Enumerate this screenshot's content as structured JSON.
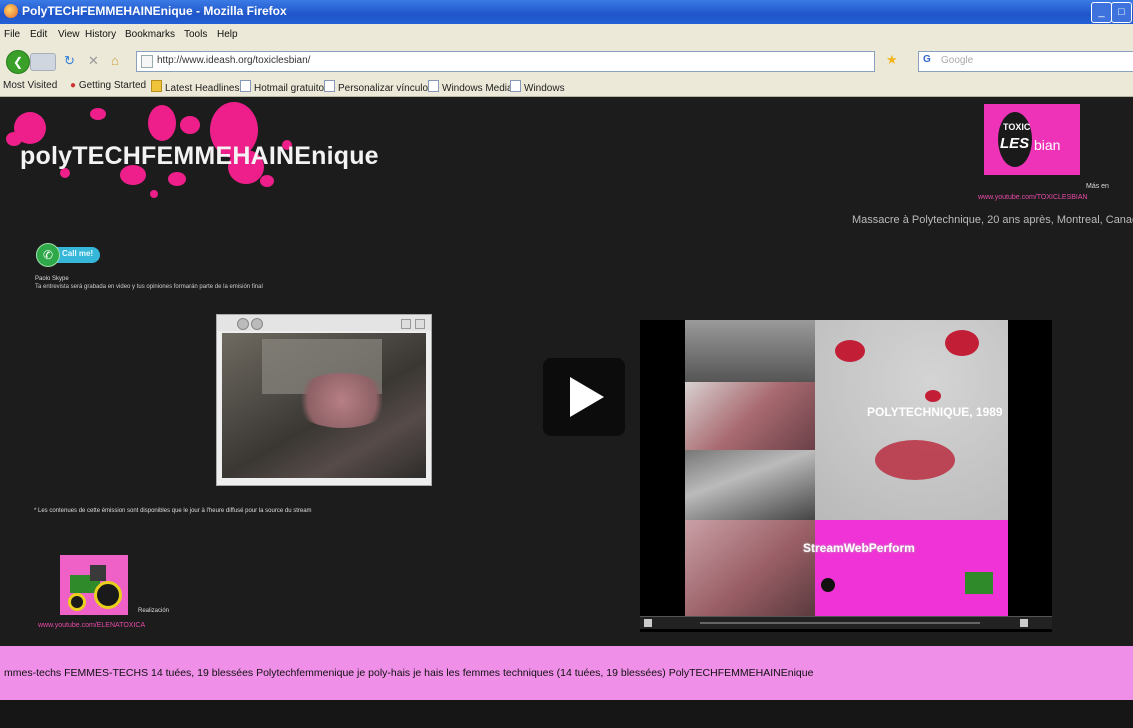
{
  "window": {
    "title": "PolyTECHFEMMEHAINEnique - Mozilla Firefox"
  },
  "menu": [
    "File",
    "Edit",
    "View",
    "History",
    "Bookmarks",
    "Tools",
    "Help"
  ],
  "nav": {
    "url": "http://www.ideash.org/toxiclesbian/",
    "search_placeholder": "Google"
  },
  "bookmarks": [
    "Most Visited",
    "Getting Started",
    "Latest Headlines",
    "Hotmail gratuito",
    "Personalizar vínculos",
    "Windows Media",
    "Windows"
  ],
  "page": {
    "site_title": "polyTECHFEMMEHAINEnique",
    "logo": {
      "line1": "TOXIC",
      "line2": "LES",
      "line3": "bian"
    },
    "mas_en": "Más en",
    "youtube_link": "www.youtube.com/TOXICLESBIAN",
    "massacre": "Massacre à Polytechnique, 20 ans après, Montreal, Canad",
    "call_button": "Call me!",
    "powered": "Paolo Skype",
    "note1": "Ta entrevista será grabada en video y tus opiniones formarán parte de la emisión final",
    "note2": "* Les contenues de cette émission sont disponibles que le jour à l'heure diffusé pour la source du stream",
    "realizacion": "Realización",
    "youtube_link2": "www.youtube.com/ELENATOXICA",
    "video_title": "POLYTECHNIQUE, 1989",
    "video_brand": "StreamWebPerform",
    "ticker": "mmes-techs FEMMES-TECHS 14 tuées, 19 blessées Polytechfemmenique je poly-hais je hais les femmes techniques (14 tuées, 19 blessées) PolyTECHFEMMEHAINEnique"
  },
  "colors": {
    "accent": "#ee1f8a",
    "ticker_bg": "#ef8fe8",
    "page_bg": "#1c1c1c"
  }
}
